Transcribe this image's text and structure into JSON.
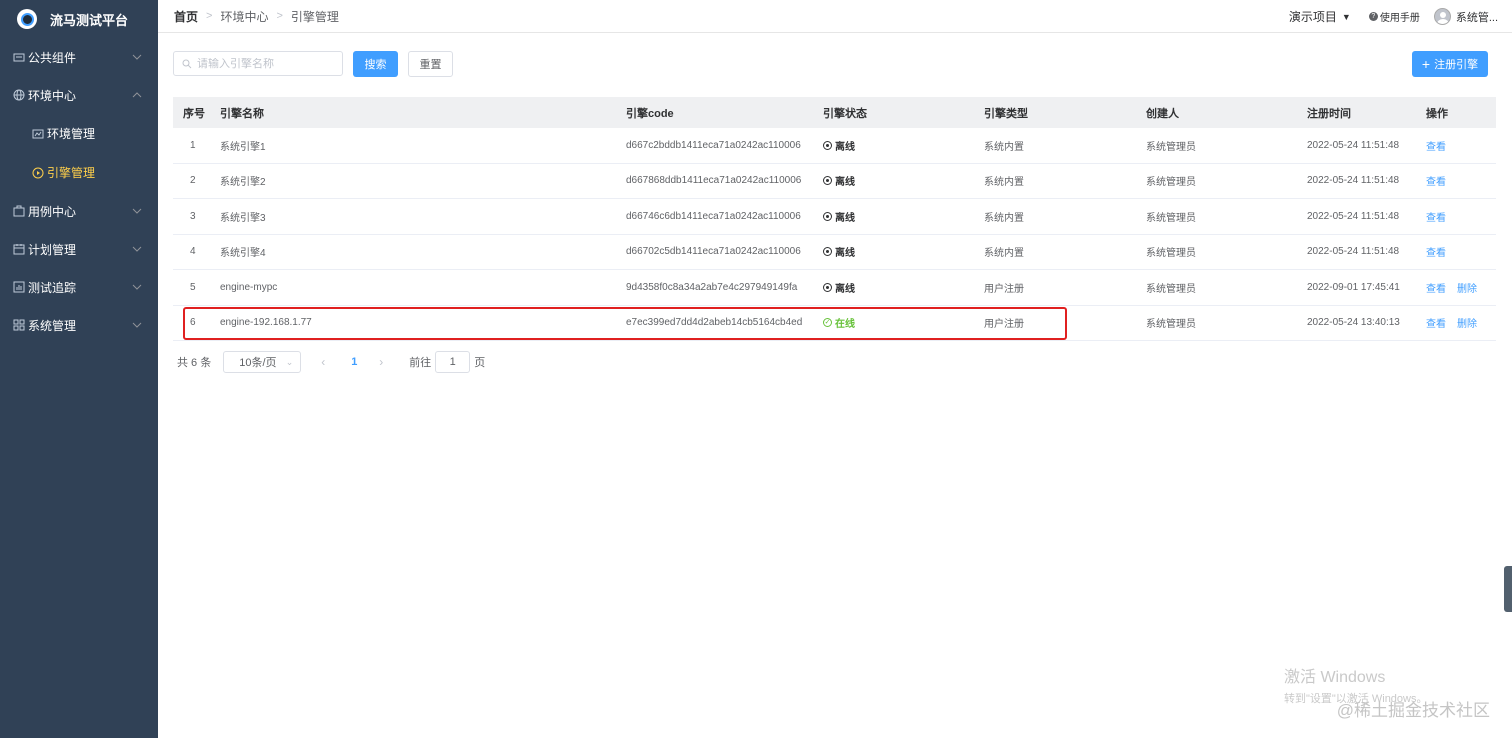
{
  "app": {
    "title": "流马测试平台"
  },
  "sidebar": {
    "items": [
      {
        "label": "公共组件",
        "icon": "component-icon"
      },
      {
        "label": "环境中心",
        "icon": "globe-icon",
        "expanded": true,
        "children": [
          {
            "label": "环境管理",
            "icon": "environment-icon"
          },
          {
            "label": "引擎管理",
            "icon": "play-circle-icon",
            "active": true
          }
        ]
      },
      {
        "label": "用例中心",
        "icon": "case-icon"
      },
      {
        "label": "计划管理",
        "icon": "calendar-icon"
      },
      {
        "label": "测试追踪",
        "icon": "chart-icon"
      },
      {
        "label": "系统管理",
        "icon": "grid-icon"
      }
    ],
    "active_color": "#ffd04b",
    "bg_color": "#304156"
  },
  "breadcrumb": {
    "home": "首页",
    "level1": "环境中心",
    "level2": "引擎管理"
  },
  "header": {
    "project": "演示项目",
    "help": "使用手册",
    "user": "系统管..."
  },
  "toolbar": {
    "search_placeholder": "请输入引擎名称",
    "search_label": "搜索",
    "reset_label": "重置",
    "register_label": "注册引擎"
  },
  "table": {
    "headers": {
      "idx": "序号",
      "name": "引擎名称",
      "code": "引擎code",
      "status": "引擎状态",
      "type": "引擎类型",
      "creator": "创建人",
      "time": "注册时间",
      "ops": "操作"
    },
    "rows": [
      {
        "idx": "1",
        "name": "系统引擎1",
        "code": "d667c2bddb1411eca71a0242ac110006",
        "status": "离线",
        "online": false,
        "type": "系统内置",
        "creator": "系统管理员",
        "time": "2022-05-24 11:51:48",
        "view": "查看",
        "delete": ""
      },
      {
        "idx": "2",
        "name": "系统引擎2",
        "code": "d667868ddb1411eca71a0242ac110006",
        "status": "离线",
        "online": false,
        "type": "系统内置",
        "creator": "系统管理员",
        "time": "2022-05-24 11:51:48",
        "view": "查看",
        "delete": ""
      },
      {
        "idx": "3",
        "name": "系统引擎3",
        "code": "d66746c6db1411eca71a0242ac110006",
        "status": "离线",
        "online": false,
        "type": "系统内置",
        "creator": "系统管理员",
        "time": "2022-05-24 11:51:48",
        "view": "查看",
        "delete": ""
      },
      {
        "idx": "4",
        "name": "系统引擎4",
        "code": "d66702c5db1411eca71a0242ac110006",
        "status": "离线",
        "online": false,
        "type": "系统内置",
        "creator": "系统管理员",
        "time": "2022-05-24 11:51:48",
        "view": "查看",
        "delete": ""
      },
      {
        "idx": "5",
        "name": "engine-mypc",
        "code": "9d4358f0c8a34a2ab7e4c297949149fa",
        "status": "离线",
        "online": false,
        "type": "用户注册",
        "creator": "系统管理员",
        "time": "2022-09-01 17:45:41",
        "view": "查看",
        "delete": "删除"
      },
      {
        "idx": "6",
        "name": "engine-192.168.1.77",
        "code": "e7ec399ed7dd4d2abeb14cb5164cb4ed",
        "status": "在线",
        "online": true,
        "type": "用户注册",
        "creator": "系统管理员",
        "time": "2022-05-24 13:40:13",
        "view": "查看",
        "delete": "删除"
      }
    ]
  },
  "pagination": {
    "total": "共 6 条",
    "page_size": "10条/页",
    "current_page": "1",
    "goto_prefix": "前往",
    "goto_value": "1",
    "goto_suffix": "页"
  },
  "overlay": {
    "watermark_line1": "激活 Windows",
    "watermark_line2": "转到\"设置\"以激活 Windows。",
    "site_mark": "@稀土掘金技术社区"
  },
  "colors": {
    "primary": "#409eff",
    "online": "#67c23a",
    "highlight": "#e02020"
  }
}
